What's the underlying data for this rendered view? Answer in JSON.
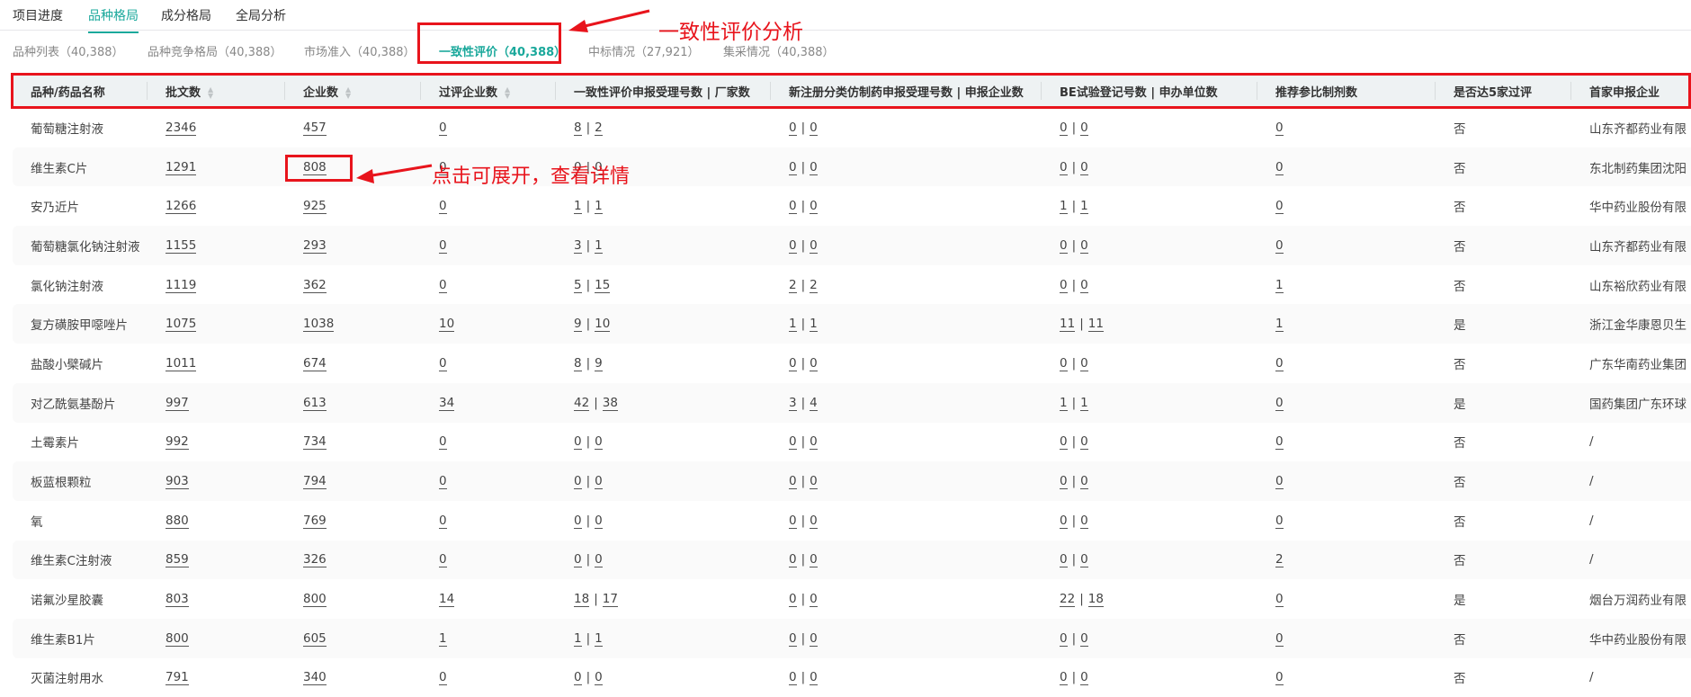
{
  "top_tabs": [
    {
      "label": "项目进度"
    },
    {
      "label": "品种格局",
      "active": true
    },
    {
      "label": "成分格局"
    },
    {
      "label": "全局分析"
    }
  ],
  "sub_tabs": [
    {
      "label": "品种列表（40,388）"
    },
    {
      "label": "品种竞争格局（40,388）"
    },
    {
      "label": "市场准入（40,388）"
    },
    {
      "label": "一致性评价（40,388）",
      "active": true
    },
    {
      "label": "中标情况（27,921）"
    },
    {
      "label": "集采情况（40,388）"
    }
  ],
  "annotations": {
    "tab_note": "一致性评价分析",
    "cell_note": "点击可展开，查看详情",
    "color": "#e8141c"
  },
  "accent": "#1aa89b",
  "columns": [
    {
      "label": "品种/药品名称"
    },
    {
      "label": "批文数",
      "sortable": true
    },
    {
      "label": "企业数",
      "sortable": true
    },
    {
      "label": "过评企业数",
      "sortable": true
    },
    {
      "label": "一致性评价申报受理号数 | 厂家数"
    },
    {
      "label": "新注册分类仿制药申报受理号数 | 申报企业数"
    },
    {
      "label": "BE试验登记号数 | 申办单位数"
    },
    {
      "label": "推荐参比制剂数"
    },
    {
      "label": "是否达5家过评"
    },
    {
      "label": "首家申报企业"
    }
  ],
  "rows": [
    [
      "葡萄糖注射液",
      "2346",
      "457",
      "0",
      [
        "8",
        "2"
      ],
      [
        "0",
        "0"
      ],
      [
        "0",
        "0"
      ],
      "0",
      "否",
      "山东齐都药业有限"
    ],
    [
      "维生素C片",
      "1291",
      "808",
      "0",
      [
        "0",
        "0"
      ],
      [
        "0",
        "0"
      ],
      [
        "0",
        "0"
      ],
      "0",
      "否",
      "东北制药集团沈阳"
    ],
    [
      "安乃近片",
      "1266",
      "925",
      "0",
      [
        "1",
        "1"
      ],
      [
        "0",
        "0"
      ],
      [
        "1",
        "1"
      ],
      "0",
      "否",
      "华中药业股份有限"
    ],
    [
      "葡萄糖氯化钠注射液",
      "1155",
      "293",
      "0",
      [
        "3",
        "1"
      ],
      [
        "0",
        "0"
      ],
      [
        "0",
        "0"
      ],
      "0",
      "否",
      "山东齐都药业有限"
    ],
    [
      "氯化钠注射液",
      "1119",
      "362",
      "0",
      [
        "5",
        "15"
      ],
      [
        "2",
        "2"
      ],
      [
        "0",
        "0"
      ],
      "1",
      "否",
      "山东裕欣药业有限"
    ],
    [
      "复方磺胺甲噁唑片",
      "1075",
      "1038",
      "10",
      [
        "9",
        "10"
      ],
      [
        "1",
        "1"
      ],
      [
        "11",
        "11"
      ],
      "1",
      "是",
      "浙江金华康恩贝生"
    ],
    [
      "盐酸小檗碱片",
      "1011",
      "674",
      "0",
      [
        "8",
        "9"
      ],
      [
        "0",
        "0"
      ],
      [
        "0",
        "0"
      ],
      "0",
      "否",
      "广东华南药业集团"
    ],
    [
      "对乙酰氨基酚片",
      "997",
      "613",
      "34",
      [
        "42",
        "38"
      ],
      [
        "3",
        "4"
      ],
      [
        "1",
        "1"
      ],
      "0",
      "是",
      "国药集团广东环球"
    ],
    [
      "土霉素片",
      "992",
      "734",
      "0",
      [
        "0",
        "0"
      ],
      [
        "0",
        "0"
      ],
      [
        "0",
        "0"
      ],
      "0",
      "否",
      "/"
    ],
    [
      "板蓝根颗粒",
      "903",
      "794",
      "0",
      [
        "0",
        "0"
      ],
      [
        "0",
        "0"
      ],
      [
        "0",
        "0"
      ],
      "0",
      "否",
      "/"
    ],
    [
      "氧",
      "880",
      "769",
      "0",
      [
        "0",
        "0"
      ],
      [
        "0",
        "0"
      ],
      [
        "0",
        "0"
      ],
      "0",
      "否",
      "/"
    ],
    [
      "维生素C注射液",
      "859",
      "326",
      "0",
      [
        "0",
        "0"
      ],
      [
        "0",
        "0"
      ],
      [
        "0",
        "0"
      ],
      "2",
      "否",
      "/"
    ],
    [
      "诺氟沙星胶囊",
      "803",
      "800",
      "14",
      [
        "18",
        "17"
      ],
      [
        "0",
        "0"
      ],
      [
        "22",
        "18"
      ],
      "0",
      "是",
      "烟台万润药业有限"
    ],
    [
      "维生素B1片",
      "800",
      "605",
      "1",
      [
        "1",
        "1"
      ],
      [
        "0",
        "0"
      ],
      [
        "0",
        "0"
      ],
      "0",
      "否",
      "华中药业股份有限"
    ],
    [
      "灭菌注射用水",
      "791",
      "340",
      "0",
      [
        "0",
        "0"
      ],
      [
        "0",
        "0"
      ],
      [
        "0",
        "0"
      ],
      "0",
      "否",
      "/"
    ]
  ]
}
